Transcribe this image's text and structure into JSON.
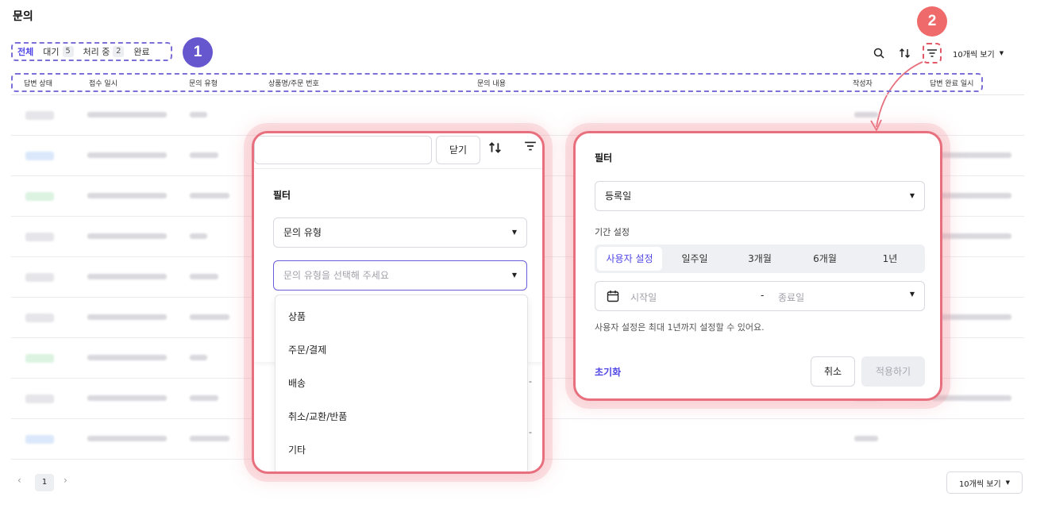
{
  "page": {
    "title": "문의"
  },
  "tabs": [
    {
      "label": "전체"
    },
    {
      "label": "대기",
      "count": "5"
    },
    {
      "label": "처리 중",
      "count": "2"
    },
    {
      "label": "완료"
    }
  ],
  "annotations": {
    "one": "1",
    "two": "2"
  },
  "toolbar": {
    "per_page": "10개씩 보기"
  },
  "table": {
    "headers": [
      "답변 상태",
      "접수 일시",
      "문의 유형",
      "상품명/주문 번호",
      "문의 내용",
      "작성자",
      "답변 완료 일시"
    ]
  },
  "left_panel": {
    "close_label": "닫기",
    "filter_title": "필터",
    "filter_field": "문의 유형",
    "type_placeholder": "문의 유형을 선택해 주세요",
    "options": [
      "상품",
      "주문/결제",
      "배송",
      "취소/교환/반품",
      "기타"
    ]
  },
  "right_panel": {
    "title": "필터",
    "date_field": "등록일",
    "period_label": "기간 설정",
    "periods": [
      "사용자 설정",
      "일주일",
      "3개월",
      "6개월",
      "1년"
    ],
    "start_placeholder": "시작일",
    "separator": "-",
    "end_placeholder": "종료일",
    "hint": "사용자 설정은 최대 1년까지 설정할 수 있어요.",
    "reset_label": "초기화",
    "cancel_label": "취소",
    "apply_label": "적용하기"
  },
  "pagination": {
    "current": "1",
    "per_page": "10개씩 보기"
  },
  "colors": {
    "accent": "#4f46e5",
    "highlight": "#e8707e",
    "annotation_purple": "#6657cf"
  }
}
